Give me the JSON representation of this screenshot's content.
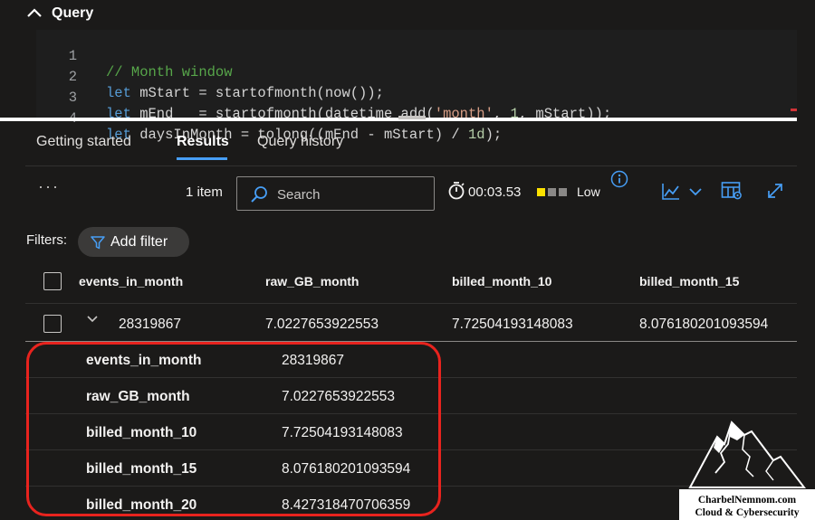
{
  "query_panel": {
    "title": "Query",
    "lines": [
      {
        "number": "1",
        "comment": "// Month window"
      },
      {
        "number": "2",
        "kw": "let",
        "rest": " mStart = startofmonth(now());"
      },
      {
        "number": "3",
        "kw": "let",
        "pre": " mEnd   = startofmonth(datetime_add(",
        "str": "'month'",
        "mid": ", ",
        "num": "1",
        "post": ", mStart));"
      },
      {
        "number": "4",
        "kw": "let",
        "pre": " daysInMonth = tolong((mEnd - mStart) / ",
        "num": "1d",
        "post": ");"
      }
    ]
  },
  "tabs": [
    {
      "label": "Getting started",
      "active": false
    },
    {
      "label": "Results",
      "active": true
    },
    {
      "label": "Query history",
      "active": false
    }
  ],
  "toolbar": {
    "more_label": "···",
    "item_count": "1 item",
    "search_placeholder": "Search",
    "elapsed": "00:03.53",
    "level_label": "Low",
    "level_colors": [
      "#fce100",
      "#8a8886",
      "#8a8886"
    ],
    "accent": "#479ef5"
  },
  "filters": {
    "label": "Filters:",
    "add_filter_label": "Add filter"
  },
  "grid": {
    "columns": [
      "events_in_month",
      "raw_GB_month",
      "billed_month_10",
      "billed_month_15"
    ],
    "row": [
      "28319867",
      "7.0227653922553",
      "7.72504193148083",
      "8.076180201093594"
    ]
  },
  "details": [
    {
      "key": "events_in_month",
      "value": "28319867"
    },
    {
      "key": "raw_GB_month",
      "value": "7.0227653922553"
    },
    {
      "key": "billed_month_10",
      "value": "7.72504193148083"
    },
    {
      "key": "billed_month_15",
      "value": "8.076180201093594"
    },
    {
      "key": "billed_month_20",
      "value": "8.427318470706359"
    }
  ],
  "highlight_color": "#e8231e",
  "watermark": {
    "line1": "CharbelNemnom.com",
    "line2": "Cloud & Cybersecurity"
  }
}
